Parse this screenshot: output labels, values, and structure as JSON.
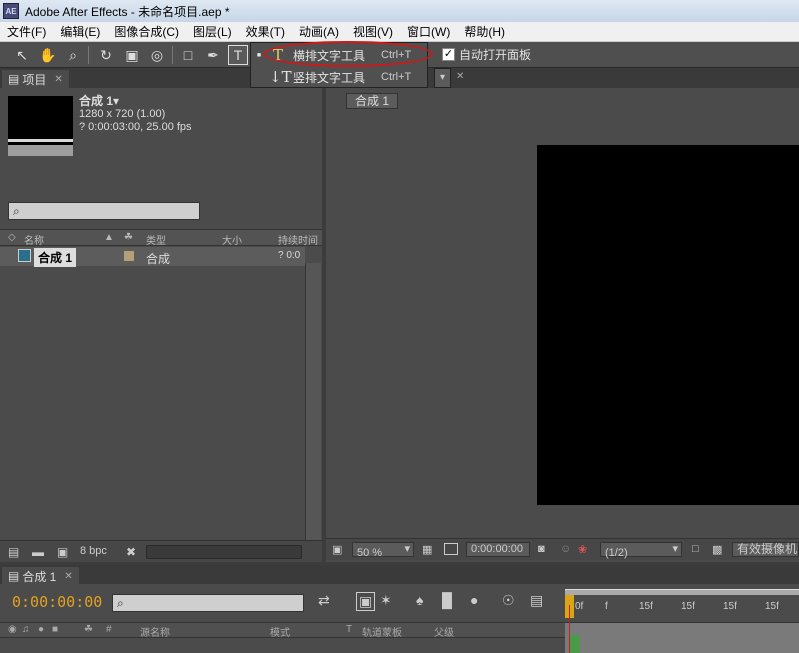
{
  "window": {
    "title": "Adobe After Effects - 未命名项目.aep *",
    "logo": "AE"
  },
  "menu": [
    "文件(F)",
    "编辑(E)",
    "图像合成(C)",
    "图层(L)",
    "效果(T)",
    "动画(A)",
    "视图(V)",
    "窗口(W)",
    "帮助(H)"
  ],
  "toolbar": {
    "auto_open_label": "自动打开面板",
    "auto_open_checked": true
  },
  "dropdown": {
    "items": [
      {
        "label": "横排文字工具",
        "shortcut": "Ctrl+T",
        "icon": "horizontal-type-icon"
      },
      {
        "label": "竖排文字工具",
        "shortcut": "Ctrl+T",
        "icon": "vertical-type-icon"
      }
    ]
  },
  "project": {
    "tab_label": "项目",
    "comp_name": "合成 1▾",
    "comp_size": "1280 x 720 (1.00)",
    "comp_duration": "? 0:00:03:00, 25.00 fps",
    "columns": [
      "名称",
      "类型",
      "大小",
      "持续时间"
    ],
    "items": [
      {
        "name": "合成 1",
        "type": "合成",
        "duration": "? 0:0"
      }
    ],
    "bpc": "8 bpc"
  },
  "composition": {
    "name_tab": "合成 1",
    "zoom": "50 %",
    "timecode": "0:00:00:00",
    "resolution": "(1/2)",
    "camera": "有效摄像机"
  },
  "timeline": {
    "tab_label": "合成 1",
    "timecode": "0:00:00:00",
    "ruler_labels": [
      "0f",
      "f",
      "15f",
      "15f",
      "15f",
      "15f"
    ],
    "columns": [
      "源名称",
      "模式",
      "T",
      "轨道蒙板",
      "父级"
    ]
  }
}
